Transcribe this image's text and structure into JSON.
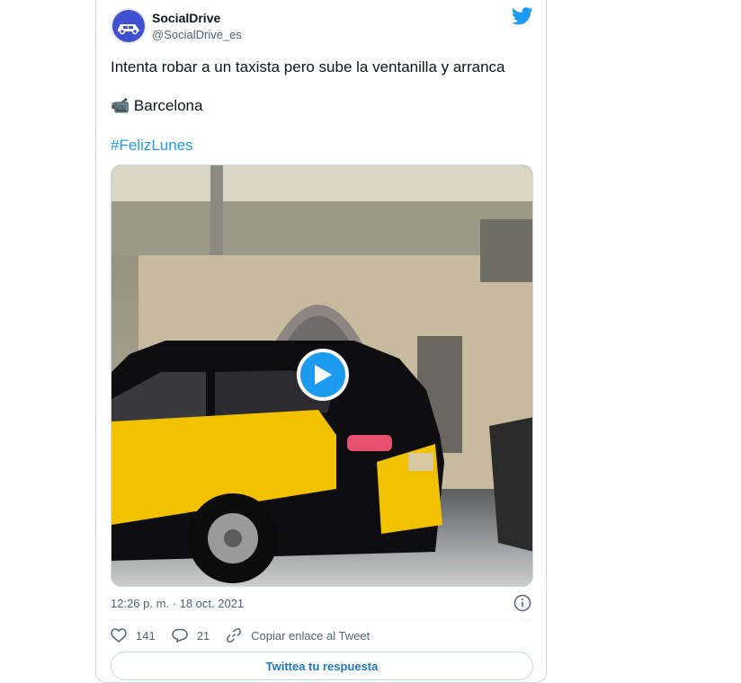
{
  "tweet": {
    "author_name": "SocialDrive",
    "author_handle": "@SocialDrive_es",
    "text_line1": "Intenta robar a un taxista pero sube la ventanilla y arranca",
    "location_emoji": "📹",
    "location": "Barcelona",
    "hashtag": "#FelizLunes",
    "timestamp": "12:26 p. m. · 18 oct. 2021",
    "likes": "141",
    "replies": "21",
    "copy_link_label": "Copiar enlace al Tweet",
    "reply_button_label": "Twittea tu respuesta"
  },
  "colors": {
    "accent": "#1d9bf0",
    "avatar_blue": "#3f51d1",
    "taxi_yellow": "#f2c200",
    "muted": "#536471"
  },
  "icons": [
    "twitter-bird-icon",
    "play-icon",
    "info-icon",
    "heart-icon",
    "reply-icon",
    "link-icon"
  ]
}
